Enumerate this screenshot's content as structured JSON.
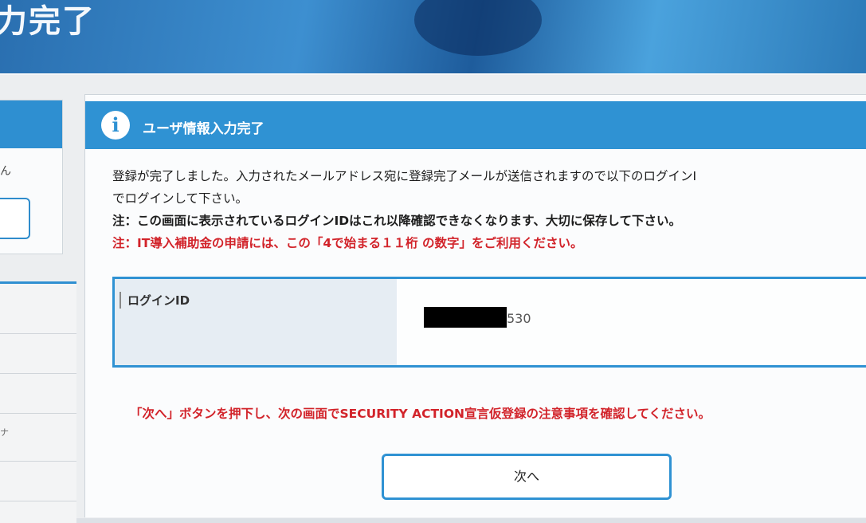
{
  "banner": {
    "title": "力完了"
  },
  "sidebar": {
    "card_text": "ん",
    "list_text": "ナ"
  },
  "panel": {
    "title": "ユーザ情報入力完了",
    "messages": {
      "line1": "登録が完了しました。入力されたメールアドレス宛に登録完了メールが送信されますので以下のログインI",
      "line2": "でログインして下さい。",
      "note1": "注：この画面に表示されているログインIDはこれ以降確認できなくなります、大切に保存して下さい。",
      "note2": "注：IT導入補助金の申請には、この「4で始まる１１桁 の数字」をご利用ください。"
    },
    "login_id": {
      "label": "ログインID",
      "value_visible": "530"
    },
    "notice": "「次へ」ボタンを押下し、次の画面でSECURITY ACTION宣言仮登録の注意事項を確認してください。",
    "next_button": "次へ"
  },
  "colors": {
    "accent": "#2f92d3",
    "warning": "#d2232a",
    "banner": "#2a6fb0"
  }
}
